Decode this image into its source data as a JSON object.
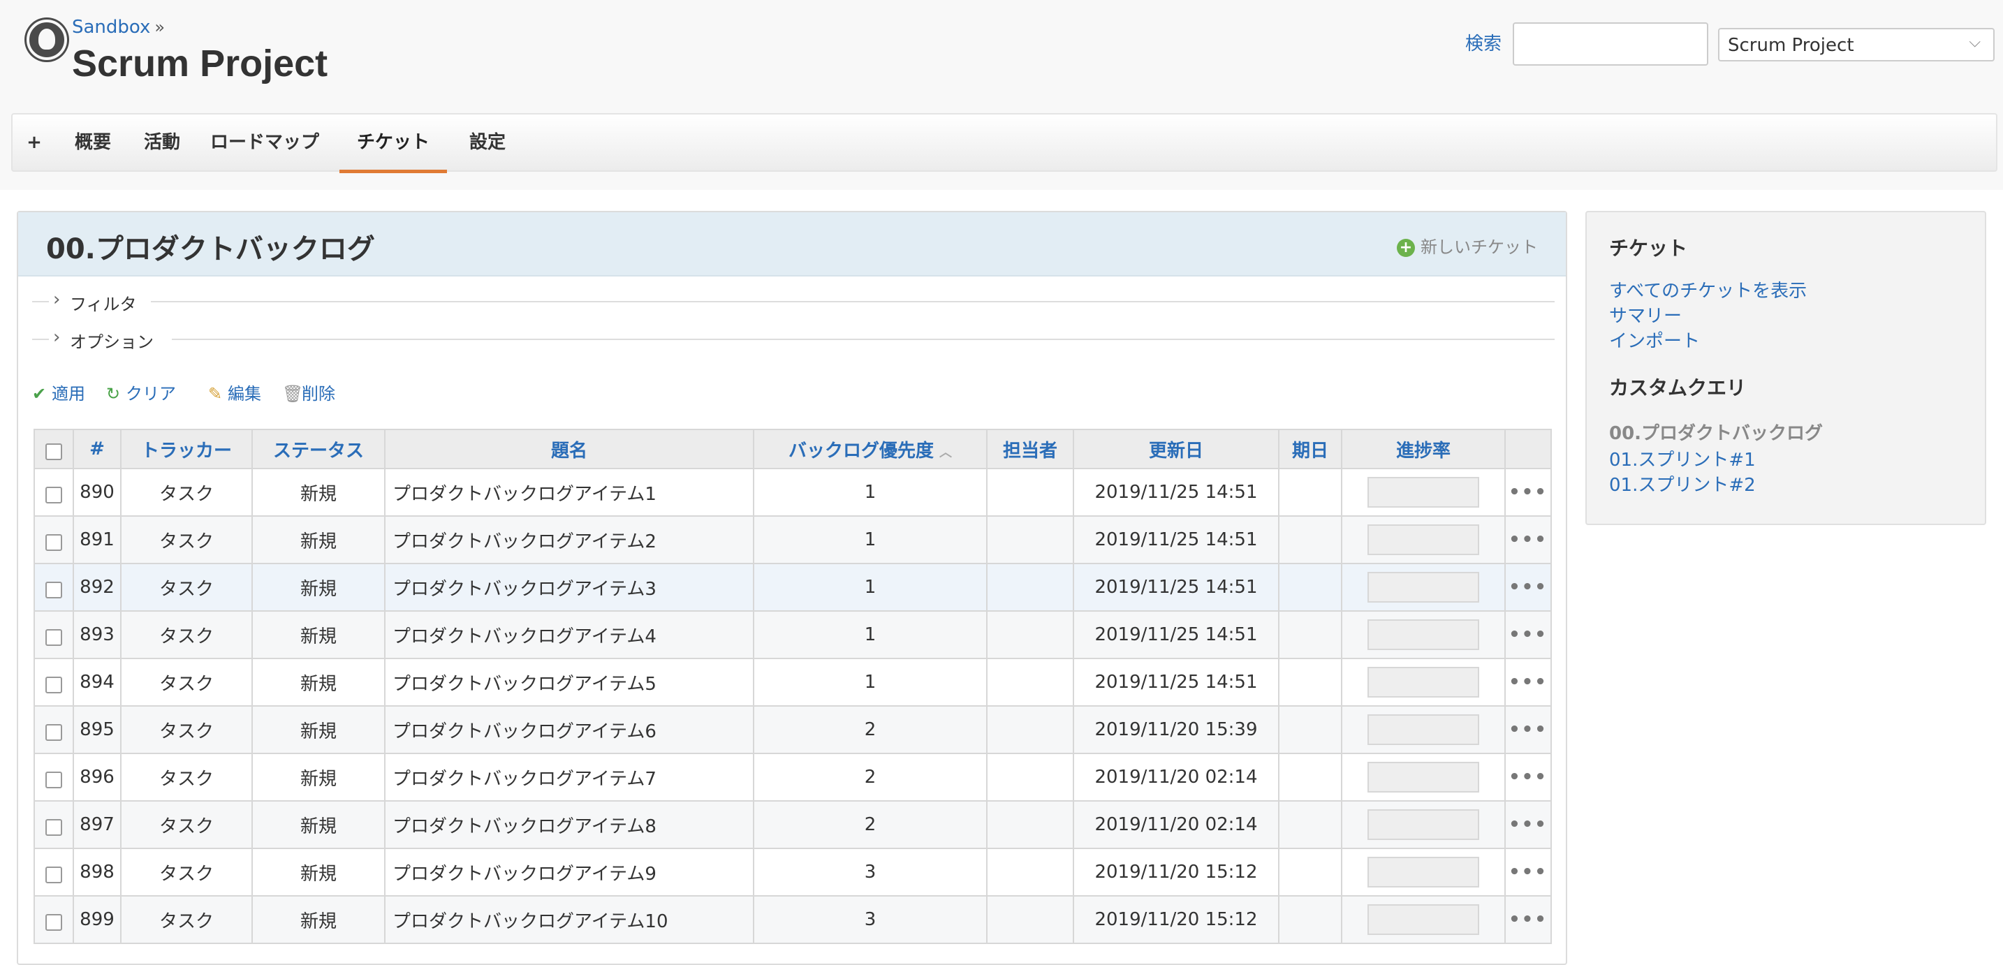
{
  "header": {
    "breadcrumb_root": "Sandbox",
    "breadcrumb_sep": "»",
    "project_title": "Scrum Project",
    "search_label": "検索",
    "search_value": "",
    "project_select_value": "Scrum Project"
  },
  "menu": {
    "add": "+",
    "items": [
      "概要",
      "活動",
      "ロードマップ",
      "チケット",
      "設定"
    ],
    "selected": "チケット"
  },
  "content": {
    "title": "00.プロダクトバックログ",
    "new_issue": "新しいチケット",
    "filter_label": "フィルタ",
    "options_label": "オプション",
    "actions": {
      "apply": "適用",
      "clear": "クリア",
      "edit": "編集",
      "delete": "削除"
    }
  },
  "table": {
    "columns": [
      "#",
      "トラッカー",
      "ステータス",
      "題名",
      "バックログ優先度",
      "担当者",
      "更新日",
      "期日",
      "進捗率"
    ],
    "rows": [
      {
        "id": "890",
        "tracker": "タスク",
        "status": "新規",
        "subject": "プロダクトバックログアイテム1",
        "priority": "1",
        "assignee": "",
        "updated": "2019/11/25 14:51",
        "due": "",
        "done_ratio": 0
      },
      {
        "id": "891",
        "tracker": "タスク",
        "status": "新規",
        "subject": "プロダクトバックログアイテム2",
        "priority": "1",
        "assignee": "",
        "updated": "2019/11/25 14:51",
        "due": "",
        "done_ratio": 0
      },
      {
        "id": "892",
        "tracker": "タスク",
        "status": "新規",
        "subject": "プロダクトバックログアイテム3",
        "priority": "1",
        "assignee": "",
        "updated": "2019/11/25 14:51",
        "due": "",
        "done_ratio": 0
      },
      {
        "id": "893",
        "tracker": "タスク",
        "status": "新規",
        "subject": "プロダクトバックログアイテム4",
        "priority": "1",
        "assignee": "",
        "updated": "2019/11/25 14:51",
        "due": "",
        "done_ratio": 0
      },
      {
        "id": "894",
        "tracker": "タスク",
        "status": "新規",
        "subject": "プロダクトバックログアイテム5",
        "priority": "1",
        "assignee": "",
        "updated": "2019/11/25 14:51",
        "due": "",
        "done_ratio": 0
      },
      {
        "id": "895",
        "tracker": "タスク",
        "status": "新規",
        "subject": "プロダクトバックログアイテム6",
        "priority": "2",
        "assignee": "",
        "updated": "2019/11/20 15:39",
        "due": "",
        "done_ratio": 0
      },
      {
        "id": "896",
        "tracker": "タスク",
        "status": "新規",
        "subject": "プロダクトバックログアイテム7",
        "priority": "2",
        "assignee": "",
        "updated": "2019/11/20 02:14",
        "due": "",
        "done_ratio": 0
      },
      {
        "id": "897",
        "tracker": "タスク",
        "status": "新規",
        "subject": "プロダクトバックログアイテム8",
        "priority": "2",
        "assignee": "",
        "updated": "2019/11/20 02:14",
        "due": "",
        "done_ratio": 0
      },
      {
        "id": "898",
        "tracker": "タスク",
        "status": "新規",
        "subject": "プロダクトバックログアイテム9",
        "priority": "3",
        "assignee": "",
        "updated": "2019/11/20 15:12",
        "due": "",
        "done_ratio": 0
      },
      {
        "id": "899",
        "tracker": "タスク",
        "status": "新規",
        "subject": "プロダクトバックログアイテム10",
        "priority": "3",
        "assignee": "",
        "updated": "2019/11/20 15:12",
        "due": "",
        "done_ratio": 0
      }
    ]
  },
  "sidebar": {
    "issues_heading": "チケット",
    "links": [
      "すべてのチケットを表示",
      "サマリー",
      "インポート"
    ],
    "custom_heading": "カスタムクエリ",
    "current_query": "00.プロダクトバックログ",
    "queries": [
      "01.スプリント#1",
      "01.スプリント#2"
    ]
  },
  "colors": {
    "link": "#2a6db8",
    "menu_selected": "#e07a34",
    "content_header_bg": "#e2edf4"
  }
}
